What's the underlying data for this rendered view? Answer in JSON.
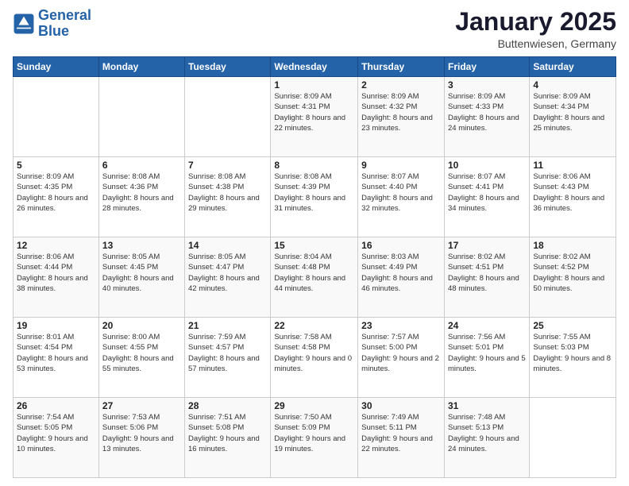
{
  "logo": {
    "line1": "General",
    "line2": "Blue"
  },
  "title": "January 2025",
  "location": "Buttenwiesen, Germany",
  "weekdays": [
    "Sunday",
    "Monday",
    "Tuesday",
    "Wednesday",
    "Thursday",
    "Friday",
    "Saturday"
  ],
  "weeks": [
    [
      {
        "day": "",
        "sunrise": "",
        "sunset": "",
        "daylight": ""
      },
      {
        "day": "",
        "sunrise": "",
        "sunset": "",
        "daylight": ""
      },
      {
        "day": "",
        "sunrise": "",
        "sunset": "",
        "daylight": ""
      },
      {
        "day": "1",
        "sunrise": "Sunrise: 8:09 AM",
        "sunset": "Sunset: 4:31 PM",
        "daylight": "Daylight: 8 hours and 22 minutes."
      },
      {
        "day": "2",
        "sunrise": "Sunrise: 8:09 AM",
        "sunset": "Sunset: 4:32 PM",
        "daylight": "Daylight: 8 hours and 23 minutes."
      },
      {
        "day": "3",
        "sunrise": "Sunrise: 8:09 AM",
        "sunset": "Sunset: 4:33 PM",
        "daylight": "Daylight: 8 hours and 24 minutes."
      },
      {
        "day": "4",
        "sunrise": "Sunrise: 8:09 AM",
        "sunset": "Sunset: 4:34 PM",
        "daylight": "Daylight: 8 hours and 25 minutes."
      }
    ],
    [
      {
        "day": "5",
        "sunrise": "Sunrise: 8:09 AM",
        "sunset": "Sunset: 4:35 PM",
        "daylight": "Daylight: 8 hours and 26 minutes."
      },
      {
        "day": "6",
        "sunrise": "Sunrise: 8:08 AM",
        "sunset": "Sunset: 4:36 PM",
        "daylight": "Daylight: 8 hours and 28 minutes."
      },
      {
        "day": "7",
        "sunrise": "Sunrise: 8:08 AM",
        "sunset": "Sunset: 4:38 PM",
        "daylight": "Daylight: 8 hours and 29 minutes."
      },
      {
        "day": "8",
        "sunrise": "Sunrise: 8:08 AM",
        "sunset": "Sunset: 4:39 PM",
        "daylight": "Daylight: 8 hours and 31 minutes."
      },
      {
        "day": "9",
        "sunrise": "Sunrise: 8:07 AM",
        "sunset": "Sunset: 4:40 PM",
        "daylight": "Daylight: 8 hours and 32 minutes."
      },
      {
        "day": "10",
        "sunrise": "Sunrise: 8:07 AM",
        "sunset": "Sunset: 4:41 PM",
        "daylight": "Daylight: 8 hours and 34 minutes."
      },
      {
        "day": "11",
        "sunrise": "Sunrise: 8:06 AM",
        "sunset": "Sunset: 4:43 PM",
        "daylight": "Daylight: 8 hours and 36 minutes."
      }
    ],
    [
      {
        "day": "12",
        "sunrise": "Sunrise: 8:06 AM",
        "sunset": "Sunset: 4:44 PM",
        "daylight": "Daylight: 8 hours and 38 minutes."
      },
      {
        "day": "13",
        "sunrise": "Sunrise: 8:05 AM",
        "sunset": "Sunset: 4:45 PM",
        "daylight": "Daylight: 8 hours and 40 minutes."
      },
      {
        "day": "14",
        "sunrise": "Sunrise: 8:05 AM",
        "sunset": "Sunset: 4:47 PM",
        "daylight": "Daylight: 8 hours and 42 minutes."
      },
      {
        "day": "15",
        "sunrise": "Sunrise: 8:04 AM",
        "sunset": "Sunset: 4:48 PM",
        "daylight": "Daylight: 8 hours and 44 minutes."
      },
      {
        "day": "16",
        "sunrise": "Sunrise: 8:03 AM",
        "sunset": "Sunset: 4:49 PM",
        "daylight": "Daylight: 8 hours and 46 minutes."
      },
      {
        "day": "17",
        "sunrise": "Sunrise: 8:02 AM",
        "sunset": "Sunset: 4:51 PM",
        "daylight": "Daylight: 8 hours and 48 minutes."
      },
      {
        "day": "18",
        "sunrise": "Sunrise: 8:02 AM",
        "sunset": "Sunset: 4:52 PM",
        "daylight": "Daylight: 8 hours and 50 minutes."
      }
    ],
    [
      {
        "day": "19",
        "sunrise": "Sunrise: 8:01 AM",
        "sunset": "Sunset: 4:54 PM",
        "daylight": "Daylight: 8 hours and 53 minutes."
      },
      {
        "day": "20",
        "sunrise": "Sunrise: 8:00 AM",
        "sunset": "Sunset: 4:55 PM",
        "daylight": "Daylight: 8 hours and 55 minutes."
      },
      {
        "day": "21",
        "sunrise": "Sunrise: 7:59 AM",
        "sunset": "Sunset: 4:57 PM",
        "daylight": "Daylight: 8 hours and 57 minutes."
      },
      {
        "day": "22",
        "sunrise": "Sunrise: 7:58 AM",
        "sunset": "Sunset: 4:58 PM",
        "daylight": "Daylight: 9 hours and 0 minutes."
      },
      {
        "day": "23",
        "sunrise": "Sunrise: 7:57 AM",
        "sunset": "Sunset: 5:00 PM",
        "daylight": "Daylight: 9 hours and 2 minutes."
      },
      {
        "day": "24",
        "sunrise": "Sunrise: 7:56 AM",
        "sunset": "Sunset: 5:01 PM",
        "daylight": "Daylight: 9 hours and 5 minutes."
      },
      {
        "day": "25",
        "sunrise": "Sunrise: 7:55 AM",
        "sunset": "Sunset: 5:03 PM",
        "daylight": "Daylight: 9 hours and 8 minutes."
      }
    ],
    [
      {
        "day": "26",
        "sunrise": "Sunrise: 7:54 AM",
        "sunset": "Sunset: 5:05 PM",
        "daylight": "Daylight: 9 hours and 10 minutes."
      },
      {
        "day": "27",
        "sunrise": "Sunrise: 7:53 AM",
        "sunset": "Sunset: 5:06 PM",
        "daylight": "Daylight: 9 hours and 13 minutes."
      },
      {
        "day": "28",
        "sunrise": "Sunrise: 7:51 AM",
        "sunset": "Sunset: 5:08 PM",
        "daylight": "Daylight: 9 hours and 16 minutes."
      },
      {
        "day": "29",
        "sunrise": "Sunrise: 7:50 AM",
        "sunset": "Sunset: 5:09 PM",
        "daylight": "Daylight: 9 hours and 19 minutes."
      },
      {
        "day": "30",
        "sunrise": "Sunrise: 7:49 AM",
        "sunset": "Sunset: 5:11 PM",
        "daylight": "Daylight: 9 hours and 22 minutes."
      },
      {
        "day": "31",
        "sunrise": "Sunrise: 7:48 AM",
        "sunset": "Sunset: 5:13 PM",
        "daylight": "Daylight: 9 hours and 24 minutes."
      },
      {
        "day": "",
        "sunrise": "",
        "sunset": "",
        "daylight": ""
      }
    ]
  ]
}
